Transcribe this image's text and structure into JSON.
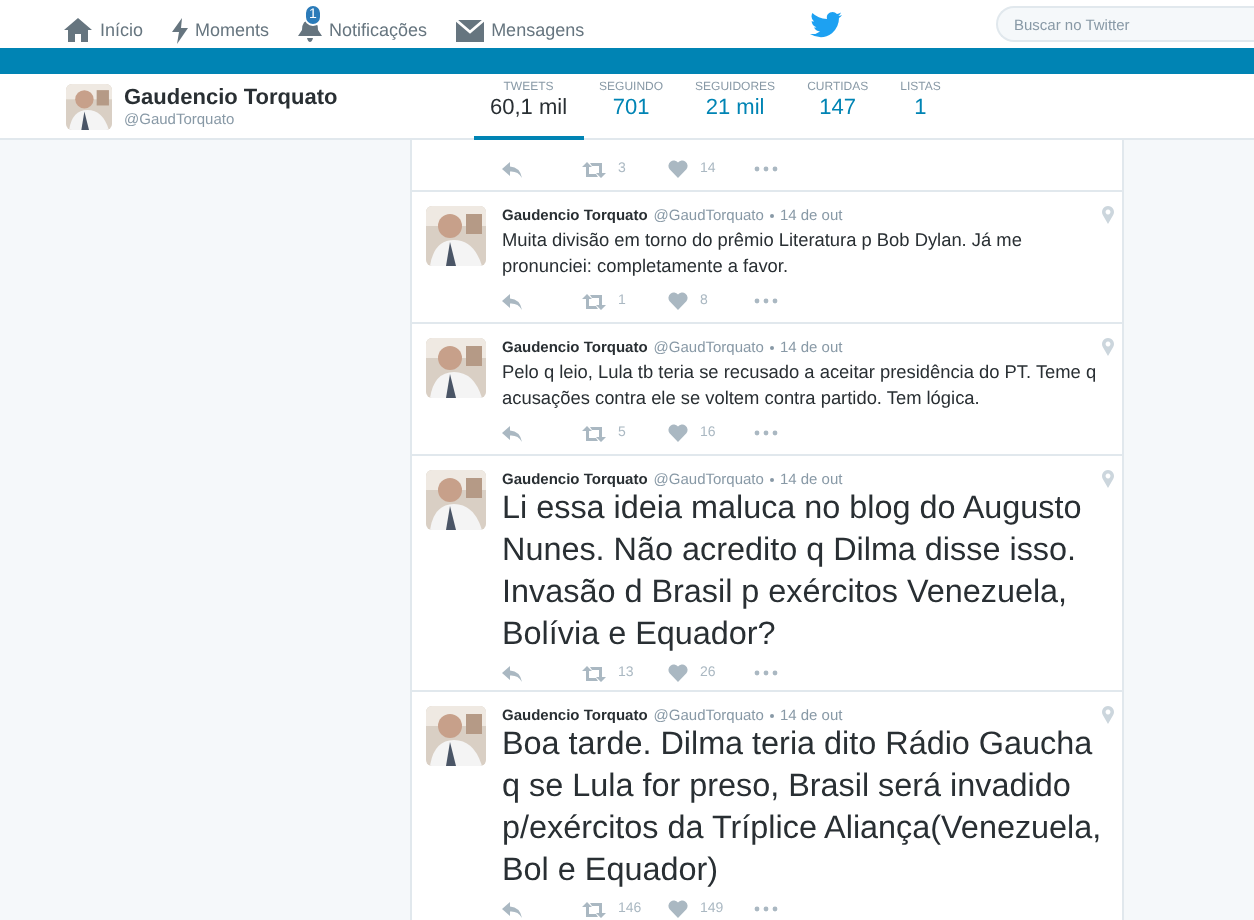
{
  "nav": {
    "items": [
      {
        "kind": "home",
        "label": "Início"
      },
      {
        "kind": "bolt",
        "label": "Moments"
      },
      {
        "kind": "bell",
        "label": "Notificações",
        "badge": "1"
      },
      {
        "kind": "mail",
        "label": "Mensagens"
      }
    ],
    "search": {
      "placeholder": "Buscar no Twitter"
    }
  },
  "profile": {
    "name": "Gaudencio Torquato",
    "handle": "@GaudTorquato",
    "stats": [
      {
        "label": "TWEETS",
        "value": "60,1 mil",
        "selected": true
      },
      {
        "label": "SEGUINDO",
        "value": "701",
        "selected": false
      },
      {
        "label": "SEGUIDORES",
        "value": "21 mil",
        "selected": false
      },
      {
        "label": "CURTIDAS",
        "value": "147",
        "selected": false
      },
      {
        "label": "LISTAS",
        "value": "1",
        "selected": false
      }
    ]
  },
  "partial_tweet": {
    "retweets": "3",
    "likes": "14"
  },
  "tweets": [
    {
      "kind": "short",
      "name": "Gaudencio Torquato",
      "handle": "@GaudTorquato",
      "time": "14 de out",
      "text": "Muita divisão em torno do prêmio Literatura p Bob Dylan. Já me pronunciei: completamente a favor.",
      "retweets": "1",
      "likes": "8"
    },
    {
      "kind": "short",
      "name": "Gaudencio Torquato",
      "handle": "@GaudTorquato",
      "time": "14 de out",
      "text": "Pelo q leio, Lula tb teria se recusado a aceitar presidência do PT. Teme q acusações contra ele se voltem contra partido. Tem lógica.",
      "retweets": "5",
      "likes": "16"
    },
    {
      "kind": "long",
      "name": "Gaudencio Torquato",
      "handle": "@GaudTorquato",
      "time": "14 de out",
      "text": "Li essa ideia maluca no blog do Augusto Nunes. Não acredito q Dilma disse isso. Invasão d Brasil p exércitos Venezuela, Bolívia e Equador?",
      "retweets": "13",
      "likes": "26"
    },
    {
      "kind": "long",
      "name": "Gaudencio Torquato",
      "handle": "@GaudTorquato",
      "time": "14 de out",
      "text": "Boa tarde. Dilma teria dito Rádio Gaucha q se Lula for preso, Brasil será invadido p/exércitos da Tríplice Aliança(Venezuela, Bol e Equador)",
      "retweets": "146",
      "likes": "149"
    }
  ]
}
